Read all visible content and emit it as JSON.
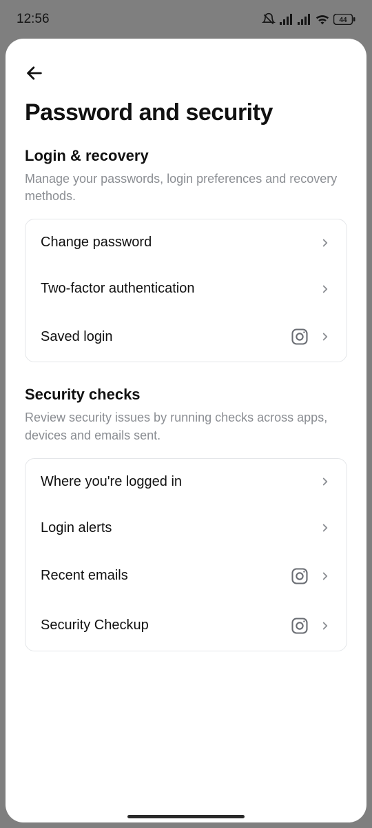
{
  "status": {
    "time": "12:56",
    "battery": "44"
  },
  "page": {
    "title": "Password and security"
  },
  "section1": {
    "title": "Login & recovery",
    "desc": "Manage your passwords, login preferences and recovery methods.",
    "items": [
      {
        "label": "Change password"
      },
      {
        "label": "Two-factor authentication"
      },
      {
        "label": "Saved login"
      }
    ]
  },
  "section2": {
    "title": "Security checks",
    "desc": "Review security issues by running checks across apps, devices and emails sent.",
    "items": [
      {
        "label": "Where you're logged in"
      },
      {
        "label": "Login alerts"
      },
      {
        "label": "Recent emails"
      },
      {
        "label": "Security Checkup"
      }
    ]
  }
}
